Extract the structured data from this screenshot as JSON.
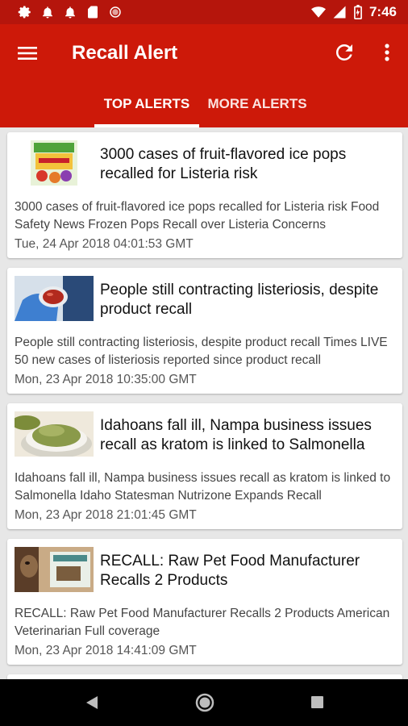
{
  "status_bar": {
    "time": "7:46",
    "left_icons": [
      "gear-icon",
      "bell-icon",
      "bell-icon",
      "sd-card-icon",
      "circle-icon"
    ],
    "right_icons": [
      "wifi-icon",
      "signal-icon",
      "battery-icon"
    ]
  },
  "app_bar": {
    "title": "Recall Alert",
    "menu_icon": "hamburger-menu-icon",
    "refresh_icon": "refresh-icon",
    "more_icon": "more-vert-icon",
    "color": "#cd1909"
  },
  "tabs": [
    {
      "label": "TOP ALERTS",
      "selected": true
    },
    {
      "label": "MORE ALERTS",
      "selected": false
    }
  ],
  "articles": [
    {
      "title": "3000 cases of fruit-flavored ice pops recalled for Listeria risk",
      "description": "3000 cases of fruit-flavored ice pops recalled for Listeria risk  Food Safety News  Frozen Pops Recall over Listeria Concerns",
      "date": "Tue, 24 Apr 2018 04:01:53 GMT",
      "thumb": "ice-pops-box-image"
    },
    {
      "title": "People still contracting listeriosis, despite product recall",
      "description": "People still contracting listeriosis, despite product recall  Times LIVE  50 new cases of listeriosis reported since product recall",
      "date": "Mon, 23 Apr 2018 10:35:00 GMT",
      "thumb": "petri-dish-glove-image"
    },
    {
      "title": "Idahoans fall ill, Nampa business issues recall as kratom is linked to Salmonella",
      "description": "Idahoans fall ill, Nampa business issues recall as kratom is linked to Salmonella  Idaho Statesman  Nutrizone Expands Recall",
      "date": "Mon, 23 Apr 2018 21:01:45 GMT",
      "thumb": "kratom-powder-image"
    },
    {
      "title": "RECALL: Raw Pet Food Manufacturer Recalls 2 Products",
      "description": "RECALL: Raw Pet Food Manufacturer Recalls 2 Products  American Veterinarian  Full coverage",
      "date": "Mon, 23 Apr 2018 14:41:09 GMT",
      "thumb": "dog-pet-food-image"
    }
  ],
  "nav_bar": {
    "back_icon": "back-triangle-icon",
    "home_icon": "home-circle-icon",
    "recents_icon": "recents-square-icon"
  }
}
